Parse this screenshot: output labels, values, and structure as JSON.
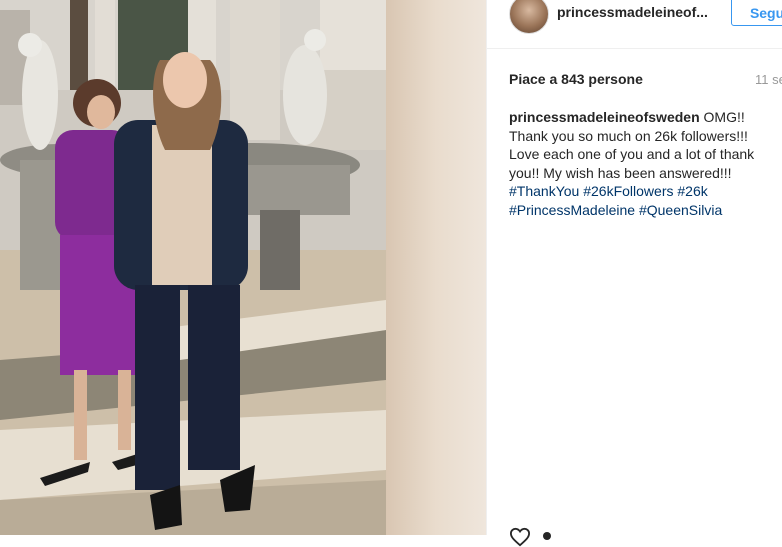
{
  "post": {
    "photo_alt": "Princess Madeleine and Queen Silvia in a courtyard",
    "username": "princessmadeleineof...",
    "follow_label": "Segui",
    "likes": "Piace a 843 persone",
    "time": "11 se",
    "caption": {
      "user": "princessmadeleineofsweden",
      "text": " OMG!! Thank you so much on 26k followers!!! Love each one of you and a lot of thank you!! My wish has been answered!!! ",
      "tags": [
        "#ThankYou",
        "#26kFollowers",
        "#26k",
        "#PrincessMadeleine",
        "#QueenSilvia"
      ]
    }
  },
  "colors": {
    "accent": "#3897f0",
    "hashtag": "#003569",
    "muted": "#999999",
    "text": "#262626"
  },
  "icons": {
    "like": "heart-icon",
    "comment": "comment-icon"
  }
}
